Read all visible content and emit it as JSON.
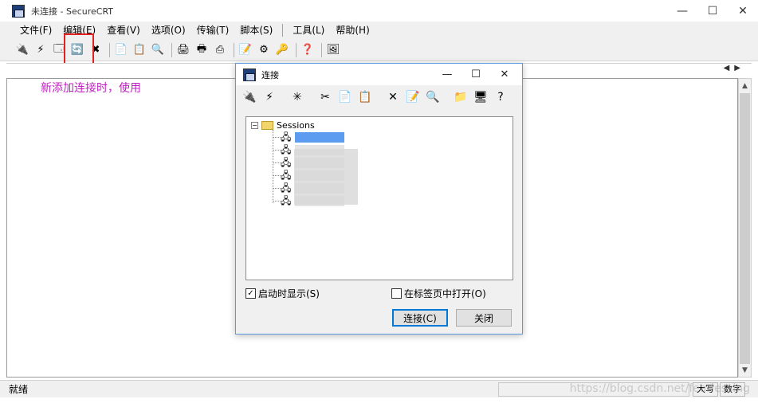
{
  "window": {
    "title": "未连接 - SecureCRT",
    "minimize": "—",
    "maximize": "☐",
    "close": "✕"
  },
  "menu": {
    "items": [
      "文件(F)",
      "编辑(E)",
      "查看(V)",
      "选项(O)",
      "传输(T)",
      "脚本(S)",
      "工具(L)",
      "帮助(H)"
    ]
  },
  "annotation": "新添加连接时，使用",
  "status": {
    "ready": "就绪",
    "caps": "大写",
    "num": "数字"
  },
  "watermark": "https://blog.csdn.net/fearlesslng",
  "dialog": {
    "title": "连接",
    "minimize": "—",
    "maximize": "☐",
    "close": "✕",
    "tree_root": "Sessions",
    "show_on_startup": "启动时显示(S)",
    "open_in_tab": "在标签页中打开(O)",
    "connect_button": "连接(C)",
    "close_button": "关闭"
  },
  "colors": {
    "accent": "#0078d7",
    "annotation": "#c020c0",
    "highlight": "#e32020",
    "selection": "#5b9cf0"
  }
}
